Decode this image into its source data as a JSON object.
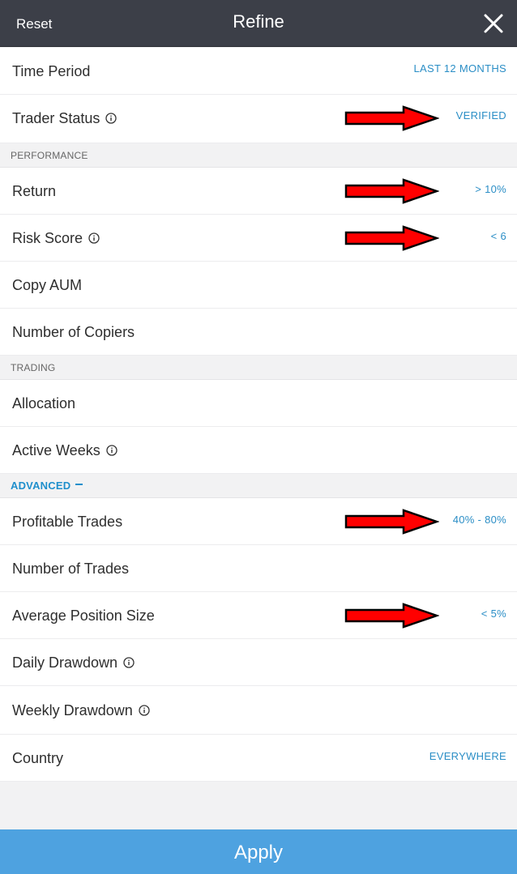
{
  "header": {
    "reset_label": "Reset",
    "title": "Refine",
    "close_icon": "close-icon"
  },
  "rows": {
    "time_period": {
      "label": "Time Period",
      "value": "LAST 12 MONTHS"
    },
    "trader_status": {
      "label": "Trader Status",
      "value": "VERIFIED"
    },
    "return": {
      "label": "Return",
      "value": "> 10%"
    },
    "risk_score": {
      "label": "Risk Score",
      "value": "< 6"
    },
    "copy_aum": {
      "label": "Copy AUM"
    },
    "copiers": {
      "label": "Number of Copiers"
    },
    "allocation": {
      "label": "Allocation"
    },
    "active_weeks": {
      "label": "Active Weeks"
    },
    "profitable_trades": {
      "label": "Profitable Trades",
      "value": "40% - 80%"
    },
    "number_of_trades": {
      "label": "Number of Trades"
    },
    "avg_position_size": {
      "label": "Average Position Size",
      "value": "< 5%"
    },
    "daily_drawdown": {
      "label": "Daily Drawdown"
    },
    "weekly_drawdown": {
      "label": "Weekly Drawdown"
    },
    "country": {
      "label": "Country",
      "value": "EVERYWHERE"
    }
  },
  "sections": {
    "performance": "PERFORMANCE",
    "trading": "TRADING",
    "advanced": "ADVANCED"
  },
  "apply_label": "Apply",
  "colors": {
    "header_bg": "#3c3f48",
    "accent": "#2b8ec6",
    "apply_bg": "#4ea2e0",
    "annotation_arrow": "#ff0000"
  },
  "icons": [
    "close-icon",
    "info-icon",
    "minus-icon",
    "annotation-arrow"
  ]
}
